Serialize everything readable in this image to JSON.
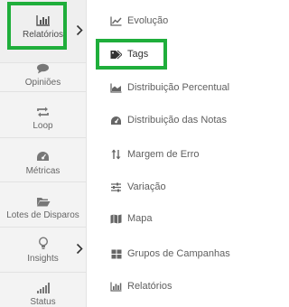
{
  "sidebar": {
    "items": [
      {
        "label": "Relatórios",
        "icon": "bar-chart-icon",
        "has_submenu": true,
        "active": true
      },
      {
        "label": "Opiniões",
        "icon": "comment-icon",
        "has_submenu": false
      },
      {
        "label": "Loop",
        "icon": "loop-icon",
        "has_submenu": false
      },
      {
        "label": "Métricas",
        "icon": "dashboard-icon",
        "has_submenu": false
      },
      {
        "label": "Lotes de Disparos",
        "icon": "folder-open-icon",
        "has_submenu": false
      },
      {
        "label": "Insights",
        "icon": "lightbulb-icon",
        "has_submenu": true
      },
      {
        "label": "Status",
        "icon": "signal-icon",
        "has_submenu": false
      }
    ]
  },
  "submenu": {
    "items": [
      {
        "label": "Evolução",
        "icon": "line-chart-icon"
      },
      {
        "label": "Tags",
        "icon": "tag-icon",
        "selected": true
      },
      {
        "label": "Distribuição Percentual",
        "icon": "area-chart-icon"
      },
      {
        "label": "Distribuição das Notas",
        "icon": "dashboard-icon"
      },
      {
        "label": "Margem de Erro",
        "icon": "sort-arrows-icon"
      },
      {
        "label": "Variação",
        "icon": "sliders-icon"
      },
      {
        "label": "Mapa",
        "icon": "map-icon"
      },
      {
        "label": "Grupos de Campanhas",
        "icon": "grid-icon"
      },
      {
        "label": "Relatórios",
        "icon": "bar-chart-icon"
      }
    ]
  },
  "colors": {
    "highlight": "#1fae3b",
    "sidebar_bg": "#f3f3f3",
    "text": "#666666"
  }
}
